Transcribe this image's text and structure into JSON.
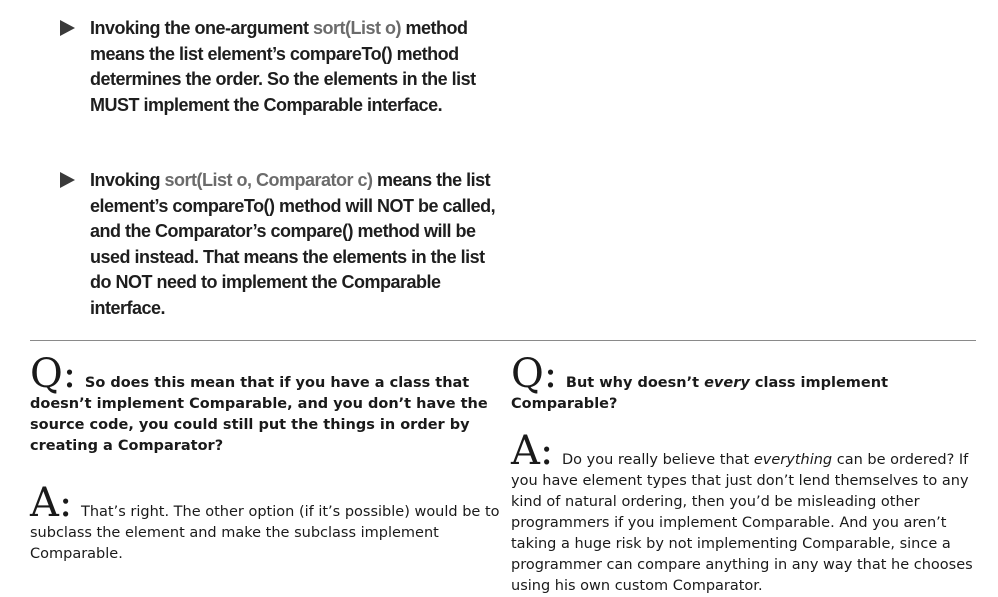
{
  "bullets": [
    {
      "parts": [
        "Invoking the one-argument ",
        "sort(List o)",
        " method means the list element’s compareTo() method determines the order. So the elements in the list MUST implement the Comparable interface."
      ]
    },
    {
      "parts": [
        "Invoking  ",
        "sort(List o, Comparator c)",
        " means the list element’s compareTo() method will NOT be called, and the Comparator’s compare() method will be used instead. That means the elements in the list do NOT need to implement the Comparable interface."
      ]
    }
  ],
  "left_qa": {
    "q_glyph": "Q:",
    "question": "So does this mean that if you have a class that doesn’t implement Comparable, and you don’t have the source code, you could still put the things in order by creating a Comparator?",
    "a_glyph": "A:",
    "answer": "That’s right. The other option (if it’s possible) would be to subclass the element and make the subclass implement Comparable."
  },
  "right_qa": {
    "q_glyph": "Q:",
    "question_before": "But why doesn’t ",
    "question_em": "every",
    "question_after": " class implement Comparable?",
    "a_glyph": "A:",
    "answer_before": "Do you really believe that ",
    "answer_em": "everything",
    "answer_after": " can be ordered? If you have element types that just don’t lend themselves to any kind of natural ordering, then you’d be misleading other programmers if you implement Comparable. And you aren’t taking a huge risk by not implementing Comparable, since a programmer can compare anything in any way that he chooses using his own custom Comparator."
  }
}
